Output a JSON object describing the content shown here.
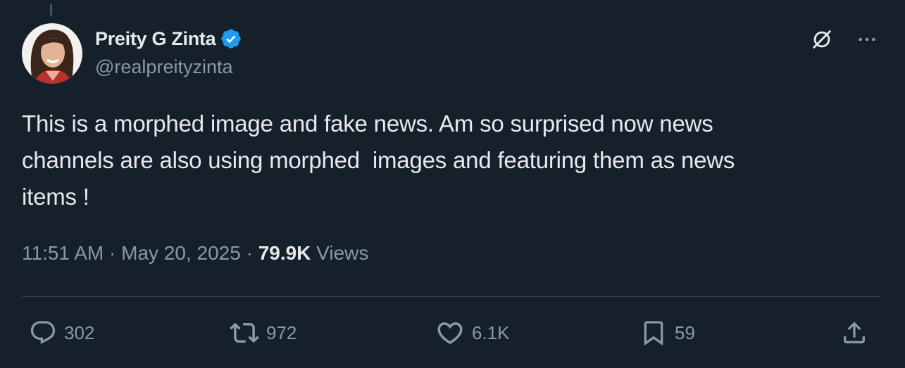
{
  "author": {
    "display_name": "Preity G Zinta",
    "handle": "@realpreityzinta",
    "verified": true,
    "verified_color": "#1d9bf0"
  },
  "tweet": {
    "text": "This is a morphed image and fake news. Am so surprised now news\nchannels are also using morphed  images and featuring them as news\nitems !"
  },
  "meta": {
    "time": "11:51 AM",
    "separator": " · ",
    "date": "May 20, 2025",
    "views_count": "79.9K",
    "views_label": " Views"
  },
  "actions": {
    "replies": "302",
    "reposts": "972",
    "likes": "6.1K",
    "bookmarks": "59"
  },
  "icons": {
    "reply": "speech-bubble-icon",
    "repost": "repost-arrows-icon",
    "like": "heart-icon",
    "bookmark": "bookmark-icon",
    "share": "share-upload-icon",
    "grok": "grok-icon",
    "more": "more-dots-icon"
  },
  "colors": {
    "background": "#15202b",
    "text_primary": "#e7e9ea",
    "text_secondary": "#8b98a5",
    "divider": "#38444d"
  }
}
